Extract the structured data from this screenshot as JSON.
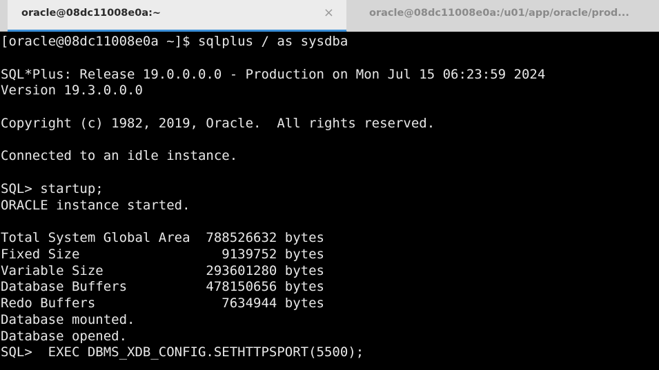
{
  "tabs": [
    {
      "label": "oracle@08dc11008e0a:~",
      "active": true,
      "close_glyph": "×"
    },
    {
      "label": "oracle@08dc11008e0a:/u01/app/oracle/prod...",
      "active": false
    }
  ],
  "terminal": {
    "lines": [
      "[oracle@08dc11008e0a ~]$ sqlplus / as sysdba",
      "",
      "SQL*Plus: Release 19.0.0.0.0 - Production on Mon Jul 15 06:23:59 2024",
      "Version 19.3.0.0.0",
      "",
      "Copyright (c) 1982, 2019, Oracle.  All rights reserved.",
      "",
      "Connected to an idle instance.",
      "",
      "SQL> startup;",
      "ORACLE instance started.",
      "",
      "Total System Global Area  788526632 bytes",
      "Fixed Size                  9139752 bytes",
      "Variable Size             293601280 bytes",
      "Database Buffers          478150656 bytes",
      "Redo Buffers                7634944 bytes",
      "Database mounted.",
      "Database opened.",
      "SQL>  EXEC DBMS_XDB_CONFIG.SETHTTPSPORT(5500);"
    ]
  },
  "colors": {
    "terminal_bg": "#000000",
    "terminal_fg": "#e8e8e8",
    "tab_accent": "#3a8fd8"
  }
}
